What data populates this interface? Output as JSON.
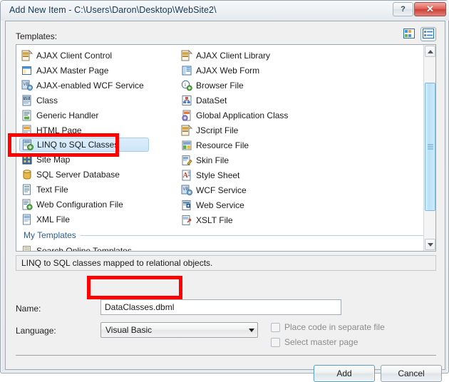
{
  "window": {
    "title": "Add New Item - C:\\Users\\Daron\\Desktop\\WebSite2\\",
    "help_button": "?",
    "close_button": "✕"
  },
  "templates_panel": {
    "label": "Templates:",
    "view_tiles_icon": "tiles-view-icon",
    "view_list_icon": "list-view-icon",
    "left_column": [
      {
        "label": "AJAX Client Control",
        "icon": "ajax-client-control-icon"
      },
      {
        "label": "AJAX Master Page",
        "icon": "master-page-icon"
      },
      {
        "label": "AJAX-enabled WCF Service",
        "icon": "wcf-service-icon"
      },
      {
        "label": "Class",
        "icon": "class-icon"
      },
      {
        "label": "Generic Handler",
        "icon": "generic-handler-icon"
      },
      {
        "label": "HTML Page",
        "icon": "html-page-icon"
      },
      {
        "label": "LINQ to SQL Classes",
        "icon": "linq-to-sql-icon",
        "selected": true
      },
      {
        "label": "Site Map",
        "icon": "site-map-icon"
      },
      {
        "label": "SQL Server Database",
        "icon": "database-icon"
      },
      {
        "label": "Text File",
        "icon": "text-file-icon"
      },
      {
        "label": "Web Configuration File",
        "icon": "web-config-icon"
      },
      {
        "label": "XML File",
        "icon": "xml-file-icon"
      }
    ],
    "right_column": [
      {
        "label": "AJAX Client Library",
        "icon": "ajax-client-library-icon"
      },
      {
        "label": "AJAX Web Form",
        "icon": "web-form-icon"
      },
      {
        "label": "Browser File",
        "icon": "browser-file-icon"
      },
      {
        "label": "DataSet",
        "icon": "dataset-icon"
      },
      {
        "label": "Global Application Class",
        "icon": "global-application-icon"
      },
      {
        "label": "JScript File",
        "icon": "jscript-file-icon"
      },
      {
        "label": "Resource File",
        "icon": "resource-file-icon"
      },
      {
        "label": "Skin File",
        "icon": "skin-file-icon"
      },
      {
        "label": "Style Sheet",
        "icon": "style-sheet-icon"
      },
      {
        "label": "WCF Service",
        "icon": "wcf-service-icon"
      },
      {
        "label": "Web Service",
        "icon": "web-service-icon"
      },
      {
        "label": "XSLT File",
        "icon": "xslt-file-icon"
      }
    ],
    "group_header": "My Templates",
    "search_online": {
      "label": "Search Online Templates...",
      "icon": "search-online-icon"
    }
  },
  "description": "LINQ to SQL classes mapped to relational objects.",
  "form": {
    "name_label": "Name:",
    "name_value": "DataClasses.dbml",
    "language_label": "Language:",
    "language_value": "Visual Basic",
    "checkbox_place_code": "Place code in separate file",
    "checkbox_select_master": "Select master page"
  },
  "buttons": {
    "add": "Add",
    "cancel": "Cancel"
  },
  "annotations": {
    "highlight_color": "#fe0000"
  }
}
